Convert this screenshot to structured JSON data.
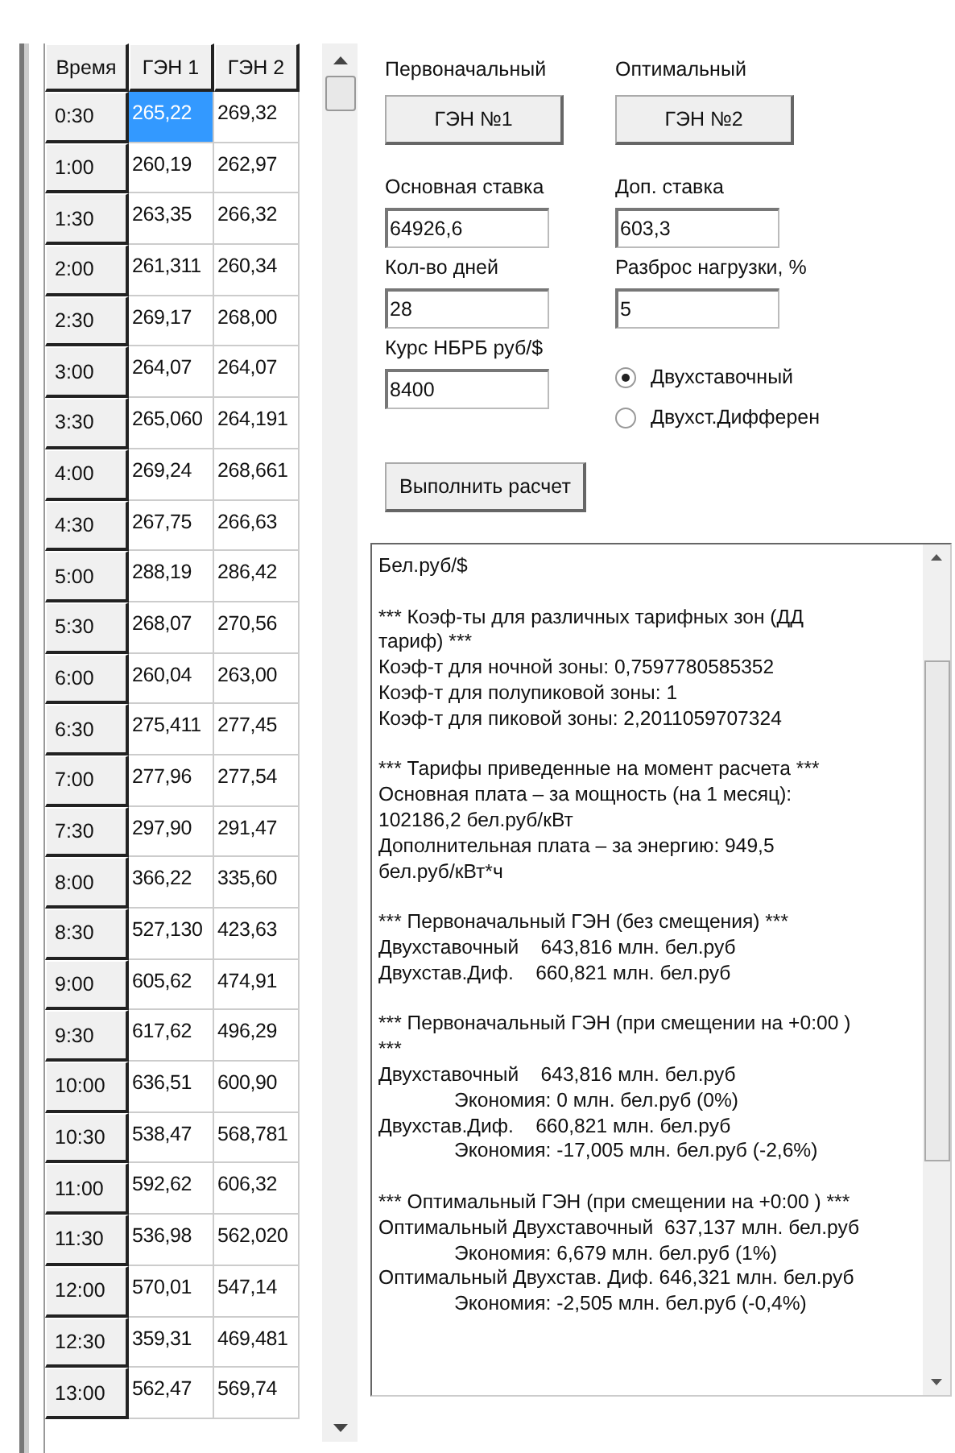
{
  "grid": {
    "time_header": "Время",
    "columns": [
      "ГЭН 1",
      "ГЭН 2"
    ],
    "rows": [
      {
        "time": "0:30",
        "cells": [
          {
            "text": "265,22",
            "selected": true
          },
          {
            "text": "269,32",
            "selected": false
          }
        ]
      },
      {
        "time": "1:00",
        "cells": [
          {
            "text": "260,19",
            "selected": false
          },
          {
            "text": "262,97",
            "selected": false
          }
        ]
      },
      {
        "time": "1:30",
        "cells": [
          {
            "text": "263,35",
            "selected": false
          },
          {
            "text": "266,32",
            "selected": false
          }
        ]
      },
      {
        "time": "2:00",
        "cells": [
          {
            "text": "261,311",
            "selected": false
          },
          {
            "text": "260,34",
            "selected": false
          }
        ]
      },
      {
        "time": "2:30",
        "cells": [
          {
            "text": "269,17",
            "selected": false
          },
          {
            "text": "268,00",
            "selected": false
          }
        ]
      },
      {
        "time": "3:00",
        "cells": [
          {
            "text": "264,07",
            "selected": false
          },
          {
            "text": "264,07",
            "selected": false
          }
        ]
      },
      {
        "time": "3:30",
        "cells": [
          {
            "text": "265,060",
            "selected": false
          },
          {
            "text": "264,191",
            "selected": false
          }
        ]
      },
      {
        "time": "4:00",
        "cells": [
          {
            "text": "269,24",
            "selected": false
          },
          {
            "text": "268,661",
            "selected": false
          }
        ]
      },
      {
        "time": "4:30",
        "cells": [
          {
            "text": "267,75",
            "selected": false
          },
          {
            "text": "266,63",
            "selected": false
          }
        ]
      },
      {
        "time": "5:00",
        "cells": [
          {
            "text": "288,19",
            "selected": false
          },
          {
            "text": "286,42",
            "selected": false
          }
        ]
      },
      {
        "time": "5:30",
        "cells": [
          {
            "text": "268,07",
            "selected": false
          },
          {
            "text": "270,56",
            "selected": false
          }
        ]
      },
      {
        "time": "6:00",
        "cells": [
          {
            "text": "260,04",
            "selected": false
          },
          {
            "text": "263,00",
            "selected": false
          }
        ]
      },
      {
        "time": "6:30",
        "cells": [
          {
            "text": "275,411",
            "selected": false
          },
          {
            "text": "277,45",
            "selected": false
          }
        ]
      },
      {
        "time": "7:00",
        "cells": [
          {
            "text": "277,96",
            "selected": false
          },
          {
            "text": "277,54",
            "selected": false
          }
        ]
      },
      {
        "time": "7:30",
        "cells": [
          {
            "text": "297,90",
            "selected": false
          },
          {
            "text": "291,47",
            "selected": false
          }
        ]
      },
      {
        "time": "8:00",
        "cells": [
          {
            "text": "366,22",
            "selected": false
          },
          {
            "text": "335,60",
            "selected": false
          }
        ]
      },
      {
        "time": "8:30",
        "cells": [
          {
            "text": "527,130",
            "selected": false
          },
          {
            "text": "423,63",
            "selected": false
          }
        ]
      },
      {
        "time": "9:00",
        "cells": [
          {
            "text": "605,62",
            "selected": false
          },
          {
            "text": "474,91",
            "selected": false
          }
        ]
      },
      {
        "time": "9:30",
        "cells": [
          {
            "text": "617,62",
            "selected": false
          },
          {
            "text": "496,29",
            "selected": false
          }
        ]
      },
      {
        "time": "10:00",
        "cells": [
          {
            "text": "636,51",
            "selected": false
          },
          {
            "text": "600,90",
            "selected": false
          }
        ]
      },
      {
        "time": "10:30",
        "cells": [
          {
            "text": "538,47",
            "selected": false
          },
          {
            "text": "568,781",
            "selected": false
          }
        ]
      },
      {
        "time": "11:00",
        "cells": [
          {
            "text": "592,62",
            "selected": false
          },
          {
            "text": "606,32",
            "selected": false
          }
        ]
      },
      {
        "time": "11:30",
        "cells": [
          {
            "text": "536,98",
            "selected": false
          },
          {
            "text": "562,020",
            "selected": false
          }
        ]
      },
      {
        "time": "12:00",
        "cells": [
          {
            "text": "570,01",
            "selected": false
          },
          {
            "text": "547,14",
            "selected": false
          }
        ]
      },
      {
        "time": "12:30",
        "cells": [
          {
            "text": "359,31",
            "selected": false
          },
          {
            "text": "469,481",
            "selected": false
          }
        ]
      },
      {
        "time": "13:00",
        "cells": [
          {
            "text": "562,47",
            "selected": false
          },
          {
            "text": "569,74",
            "selected": false
          }
        ]
      }
    ]
  },
  "gen_buttons": [
    {
      "label": "Первоначальный",
      "button": "ГЭН №1"
    },
    {
      "label": "Оптимальный",
      "button": "ГЭН №2"
    }
  ],
  "fields": [
    {
      "label": "Основная ставка",
      "value": "64926,6"
    },
    {
      "label": "Доп. ставка",
      "value": "603,3"
    },
    {
      "label": "Кол-во дней",
      "value": "28"
    },
    {
      "label": "Разброс нагрузки, %",
      "value": "5"
    },
    {
      "label": "Курс НБРБ руб/$",
      "value": "8400"
    }
  ],
  "tariff_options": [
    {
      "label": "Двухставочный",
      "selected": true
    },
    {
      "label": "Двухст.Дифферен",
      "selected": false
    }
  ],
  "run_button": "Выполнить расчет",
  "output": [
    {
      "lines": [
        {
          "text": "Бел.руб/$",
          "indented": false
        }
      ]
    },
    {
      "lines": [
        {
          "text": "*** Коэф-ты для различных тарифных зон (ДД",
          "indented": false
        },
        {
          "text": "тариф) ***",
          "indented": false
        },
        {
          "text": "Коэф-т для ночной зоны: 0,7597780585352",
          "indented": false
        },
        {
          "text": "Коэф-т для полупиковой зоны: 1",
          "indented": false
        },
        {
          "text": "Коэф-т для пиковой зоны: 2,2011059707324",
          "indented": false
        }
      ]
    },
    {
      "lines": [
        {
          "text": "*** Тарифы приведенные на момент расчета ***",
          "indented": false
        },
        {
          "text": "Основная плата – за мощность (на 1 месяц):",
          "indented": false
        },
        {
          "text": "102186,2 бел.руб/кВт",
          "indented": false
        },
        {
          "text": "Дополнительная плата – за энергию: 949,5",
          "indented": false
        },
        {
          "text": "бел.руб/кВт*ч",
          "indented": false
        }
      ]
    },
    {
      "lines": [
        {
          "text": "*** Первоначальный ГЭН (без смещения) ***",
          "indented": false
        },
        {
          "text": "Двухставочный    643,816 млн. бел.руб",
          "indented": false
        },
        {
          "text": "Двухстав.Диф.    660,821 млн. бел.руб",
          "indented": false
        }
      ]
    },
    {
      "lines": [
        {
          "text": "*** Первоначальный ГЭН (при смещении на +0:00 )",
          "indented": false
        },
        {
          "text": "***",
          "indented": false
        },
        {
          "text": "Двухставочный    643,816 млн. бел.руб",
          "indented": false
        },
        {
          "text": "Экономия: 0 млн. бел.руб (0%)",
          "indented": true
        },
        {
          "text": "Двухстав.Диф.    660,821 млн. бел.руб",
          "indented": false
        },
        {
          "text": "Экономия: -17,005 млн. бел.руб (-2,6%)",
          "indented": true
        }
      ]
    },
    {
      "lines": [
        {
          "text": "*** Оптимальный ГЭН (при смещении на +0:00 ) ***",
          "indented": false
        },
        {
          "text": "Оптимальный Двухставочный  637,137 млн. бел.руб",
          "indented": false
        },
        {
          "text": "Экономия: 6,679 млн. бел.руб (1%)",
          "indented": true
        },
        {
          "text": "Оптимальный Двухстав. Диф. 646,321 млн. бел.руб",
          "indented": false
        },
        {
          "text": "Экономия: -2,505 млн. бел.руб (-0,4%)",
          "indented": true
        }
      ]
    }
  ]
}
